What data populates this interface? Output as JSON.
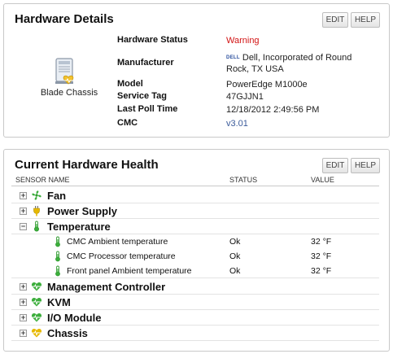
{
  "hardware_details": {
    "title": "Hardware Details",
    "edit_label": "EDIT",
    "help_label": "HELP",
    "chassis_label": "Blade Chassis",
    "rows": [
      {
        "label": "Hardware Status",
        "value": "Warning"
      },
      {
        "label": "Manufacturer",
        "value": "Dell, Incorporated of Round Rock, TX USA",
        "logo": "DELL"
      },
      {
        "label": "Model",
        "value": "PowerEdge M1000e"
      },
      {
        "label": "Service Tag",
        "value": "47GJJN1"
      },
      {
        "label": "Last Poll Time",
        "value": "12/18/2012 2:49:56 PM"
      },
      {
        "label": "CMC",
        "value": "v3.01"
      }
    ],
    "status_color": "#d21414"
  },
  "hardware_health": {
    "title": "Current Hardware Health",
    "edit_label": "EDIT",
    "help_label": "HELP",
    "columns": [
      "SENSOR NAME",
      "STATUS",
      "VALUE"
    ],
    "categories": [
      {
        "name": "Fan",
        "icon": "fan-icon",
        "toggle": "+"
      },
      {
        "name": "Power Supply",
        "icon": "power-plug-icon",
        "toggle": "+"
      },
      {
        "name": "Temperature",
        "icon": "thermometer-icon",
        "toggle": "−"
      },
      {
        "name": "Management Controller",
        "icon": "heartbeat-icon",
        "toggle": "+"
      },
      {
        "name": "KVM",
        "icon": "heartbeat-icon",
        "toggle": "+"
      },
      {
        "name": "I/O Module",
        "icon": "heartbeat-icon",
        "toggle": "+"
      },
      {
        "name": "Chassis",
        "icon": "heartbeat-warning-icon",
        "toggle": "+"
      }
    ],
    "temperature_sensors": [
      {
        "name": "CMC Ambient temperature",
        "status": "Ok",
        "value": "32 °F"
      },
      {
        "name": "CMC Processor temperature",
        "status": "Ok",
        "value": "32 °F"
      },
      {
        "name": "Front panel Ambient temperature",
        "status": "Ok",
        "value": "32 °F"
      }
    ],
    "colors": {
      "ok": "#3cae3c",
      "warning": "#e6b800"
    }
  }
}
